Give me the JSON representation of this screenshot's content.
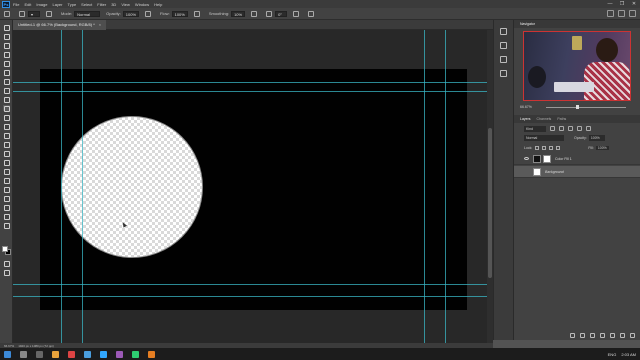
{
  "app": {
    "logo": "Ps"
  },
  "menu": [
    "File",
    "Edit",
    "Image",
    "Layer",
    "Type",
    "Select",
    "Filter",
    "3D",
    "View",
    "Window",
    "Help"
  ],
  "window_controls": [
    "—",
    "❐",
    "✕"
  ],
  "options": {
    "mode_label": "Mode:",
    "mode_value": "Normal",
    "opacity_label": "Opacity:",
    "opacity_value": "100%",
    "flow_label": "Flow:",
    "flow_value": "100%",
    "smoothing_label": "Smoothing:",
    "smoothing_value": "10%",
    "angle_value": "0°"
  },
  "document": {
    "tab_title": "Untitled-1 @ 66.7% (Background, RGB/8) *",
    "tab_close": "×",
    "zoom_status": "66.67%",
    "size_status": "1920 px x 1080 px (72 ppi)"
  },
  "panels": {
    "navigator_tab": "Navigator",
    "nav_zoom": "66.67%",
    "layers_tabs": [
      "Layers",
      "Channels",
      "Paths"
    ],
    "filter_placeholder": "Kind",
    "blend_mode": "Normal",
    "opacity_label": "Opacity:",
    "opacity_value": "100%",
    "lock_label": "Lock:",
    "fill_label": "Fill:",
    "fill_value": "100%",
    "layers": [
      {
        "name": "Color Fill 1",
        "thumb_color": "#111111",
        "selected": false
      },
      {
        "name": "Background",
        "thumb_color": "#ffffff",
        "selected": true
      }
    ]
  },
  "taskbar": {
    "lang": "ENG",
    "time": "2:03 AM"
  },
  "colors": {
    "canvas": "#010101",
    "guide": "#39b6c4",
    "workspace": "#282828"
  }
}
